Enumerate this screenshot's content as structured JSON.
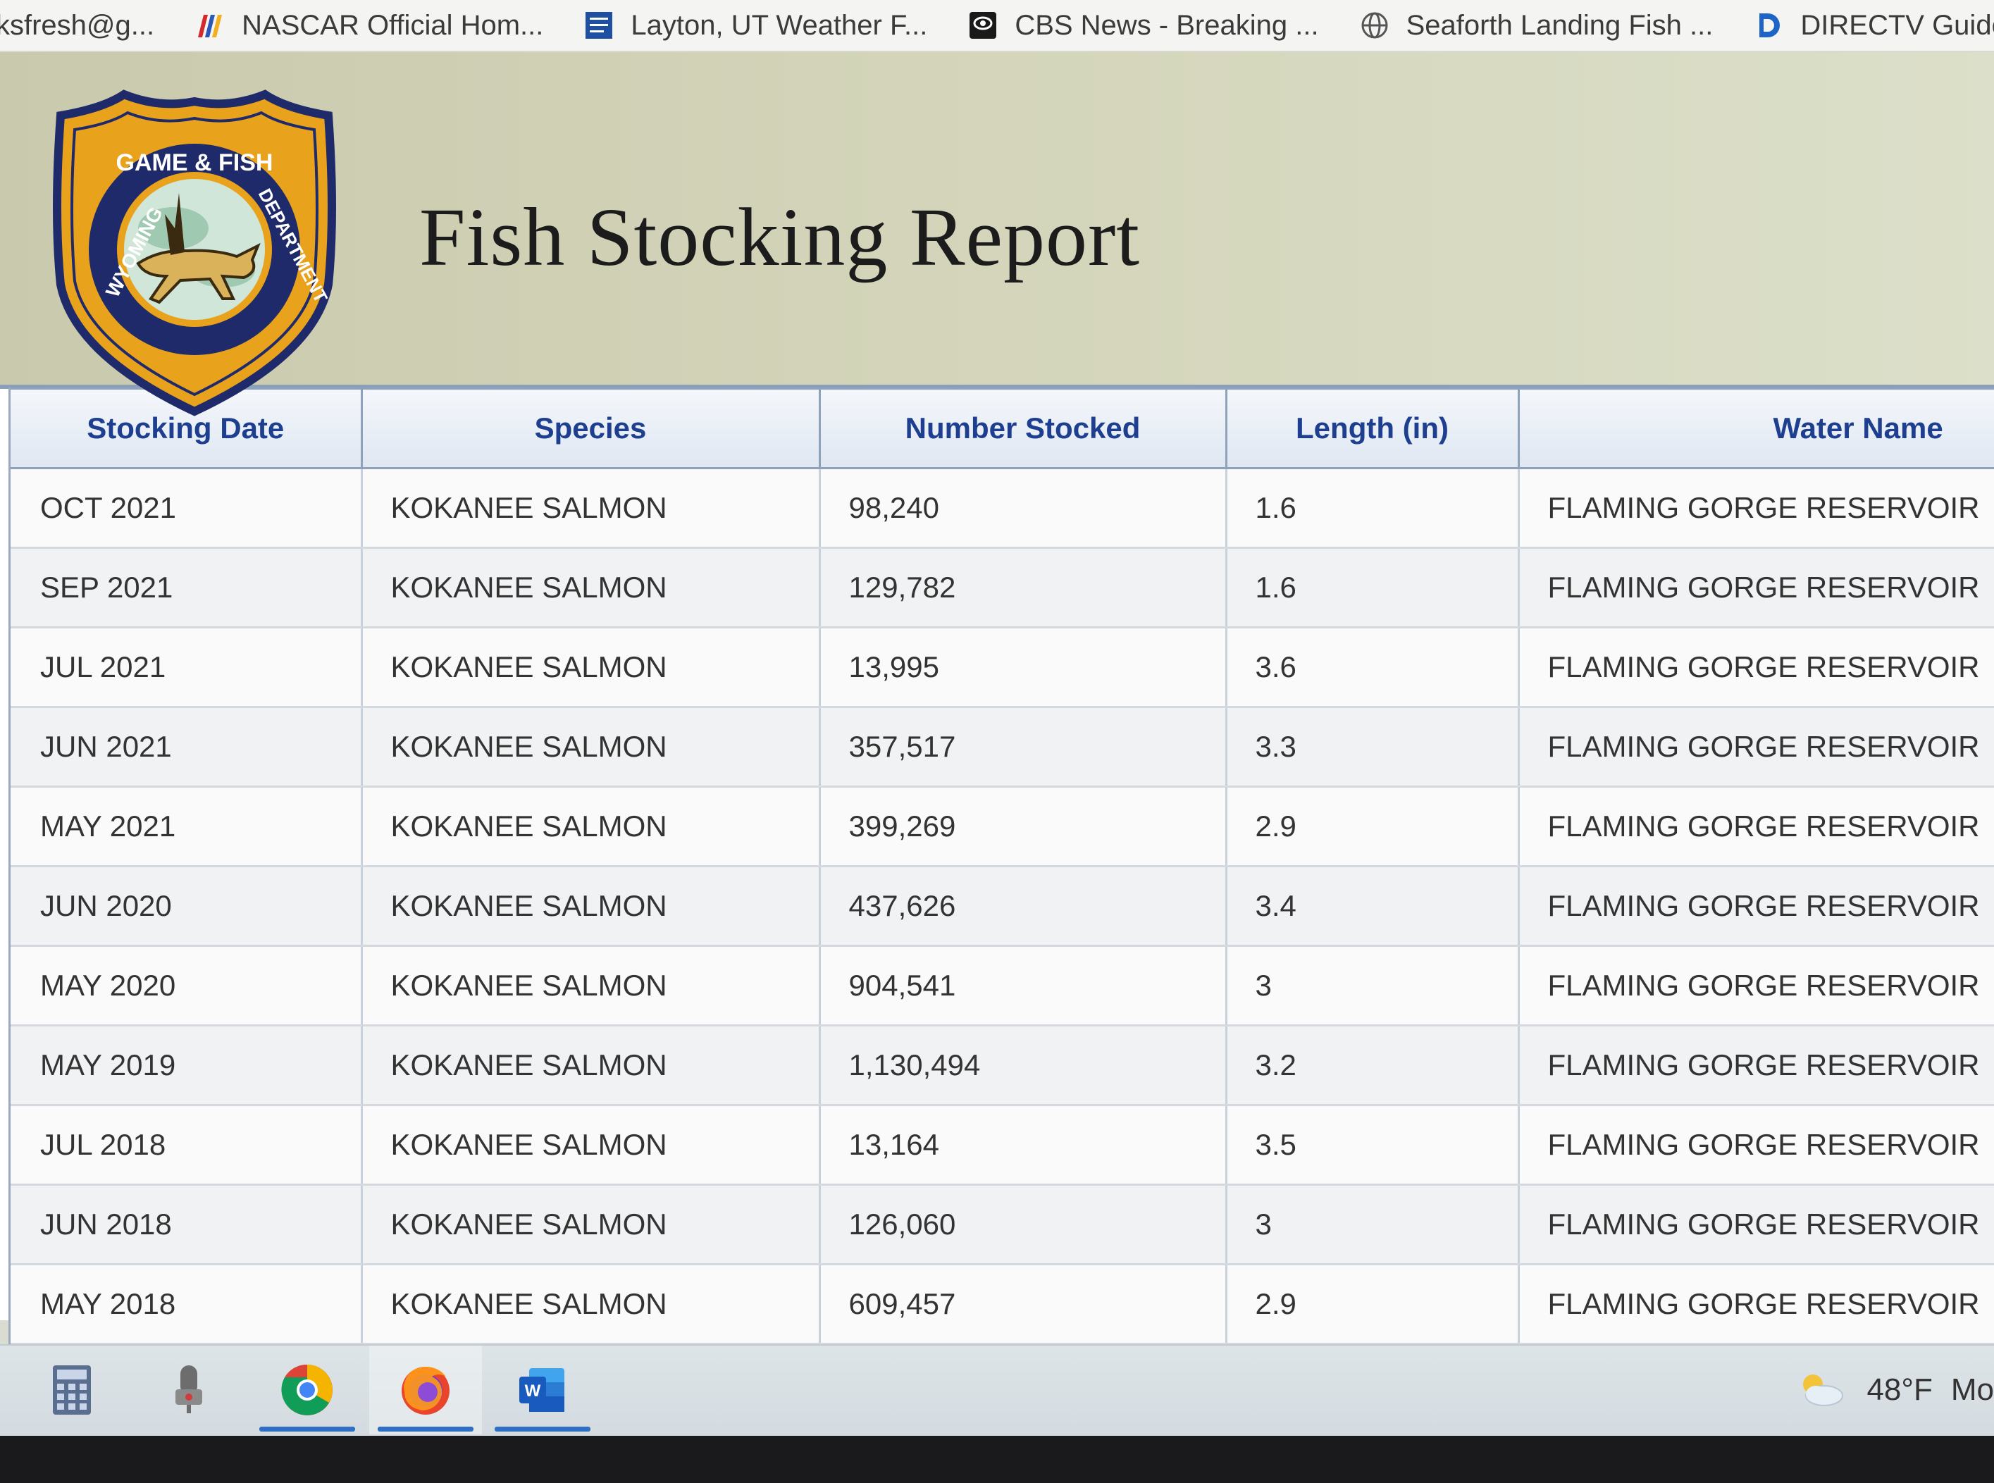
{
  "bookmarks": [
    {
      "label": "ksfresh@g...",
      "icon": "mail-icon"
    },
    {
      "label": "NASCAR Official Hom...",
      "icon": "nascar-icon"
    },
    {
      "label": "Layton, UT Weather F...",
      "icon": "weather-channel-icon"
    },
    {
      "label": "CBS News - Breaking ...",
      "icon": "cbs-icon"
    },
    {
      "label": "Seaforth Landing Fish ...",
      "icon": "globe-icon"
    },
    {
      "label": "DIRECTV Guide &",
      "icon": "directv-icon"
    }
  ],
  "header": {
    "title": "Fish Stocking Report",
    "logo_text_top": "GAME & FISH",
    "logo_text_left": "WYOMING",
    "logo_text_right": "DEPARTMENT"
  },
  "table": {
    "columns": [
      "Stocking Date",
      "Species",
      "Number Stocked",
      "Length (in)",
      "Water Name"
    ],
    "rows": [
      [
        "OCT 2021",
        "KOKANEE SALMON",
        "98,240",
        "1.6",
        "FLAMING GORGE RESERVOIR"
      ],
      [
        "SEP 2021",
        "KOKANEE SALMON",
        "129,782",
        "1.6",
        "FLAMING GORGE RESERVOIR"
      ],
      [
        "JUL 2021",
        "KOKANEE SALMON",
        "13,995",
        "3.6",
        "FLAMING GORGE RESERVOIR"
      ],
      [
        "JUN 2021",
        "KOKANEE SALMON",
        "357,517",
        "3.3",
        "FLAMING GORGE RESERVOIR"
      ],
      [
        "MAY 2021",
        "KOKANEE SALMON",
        "399,269",
        "2.9",
        "FLAMING GORGE RESERVOIR"
      ],
      [
        "JUN 2020",
        "KOKANEE SALMON",
        "437,626",
        "3.4",
        "FLAMING GORGE RESERVOIR"
      ],
      [
        "MAY 2020",
        "KOKANEE SALMON",
        "904,541",
        "3",
        "FLAMING GORGE RESERVOIR"
      ],
      [
        "MAY 2019",
        "KOKANEE SALMON",
        "1,130,494",
        "3.2",
        "FLAMING GORGE RESERVOIR"
      ],
      [
        "JUL 2018",
        "KOKANEE SALMON",
        "13,164",
        "3.5",
        "FLAMING GORGE RESERVOIR"
      ],
      [
        "JUN 2018",
        "KOKANEE SALMON",
        "126,060",
        "3",
        "FLAMING GORGE RESERVOIR"
      ],
      [
        "MAY 2018",
        "KOKANEE SALMON",
        "609,457",
        "2.9",
        "FLAMING GORGE RESERVOIR"
      ]
    ]
  },
  "taskbar": {
    "apps": [
      {
        "name": "calculator-app",
        "icon": "calculator-icon",
        "active": false
      },
      {
        "name": "voice-recorder-app",
        "icon": "microphone-icon",
        "active": false
      },
      {
        "name": "chrome-app",
        "icon": "chrome-icon",
        "active": true
      },
      {
        "name": "firefox-app",
        "icon": "firefox-icon",
        "active": true
      },
      {
        "name": "word-app",
        "icon": "word-icon",
        "active": true
      }
    ],
    "weather": {
      "temperature": "48°F",
      "condition_abbrev": "Mo",
      "icon": "partly-cloudy-icon"
    }
  },
  "colors": {
    "header_text": "#1e3f8f",
    "header_bg": "#d3d4b9",
    "logo_gold": "#e8a21c",
    "logo_navy": "#1f2a6b"
  }
}
